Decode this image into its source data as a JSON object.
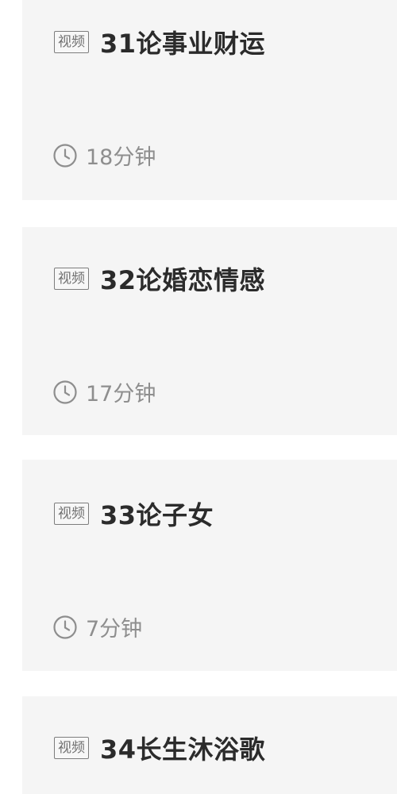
{
  "lessons": [
    {
      "badge": "视频",
      "title": "31论事业财运",
      "duration": "18分钟"
    },
    {
      "badge": "视频",
      "title": "32论婚恋情感",
      "duration": "17分钟"
    },
    {
      "badge": "视频",
      "title": "33论子女",
      "duration": "7分钟"
    },
    {
      "badge": "视频",
      "title": "34长生沐浴歌"
    }
  ],
  "icons": {
    "duration_icon": "clock-icon"
  },
  "colors": {
    "card_background": "#f5f5f5",
    "title_text": "#2b2b2b",
    "meta_text": "#8e8e8e",
    "badge_border": "#7d7d7d"
  }
}
